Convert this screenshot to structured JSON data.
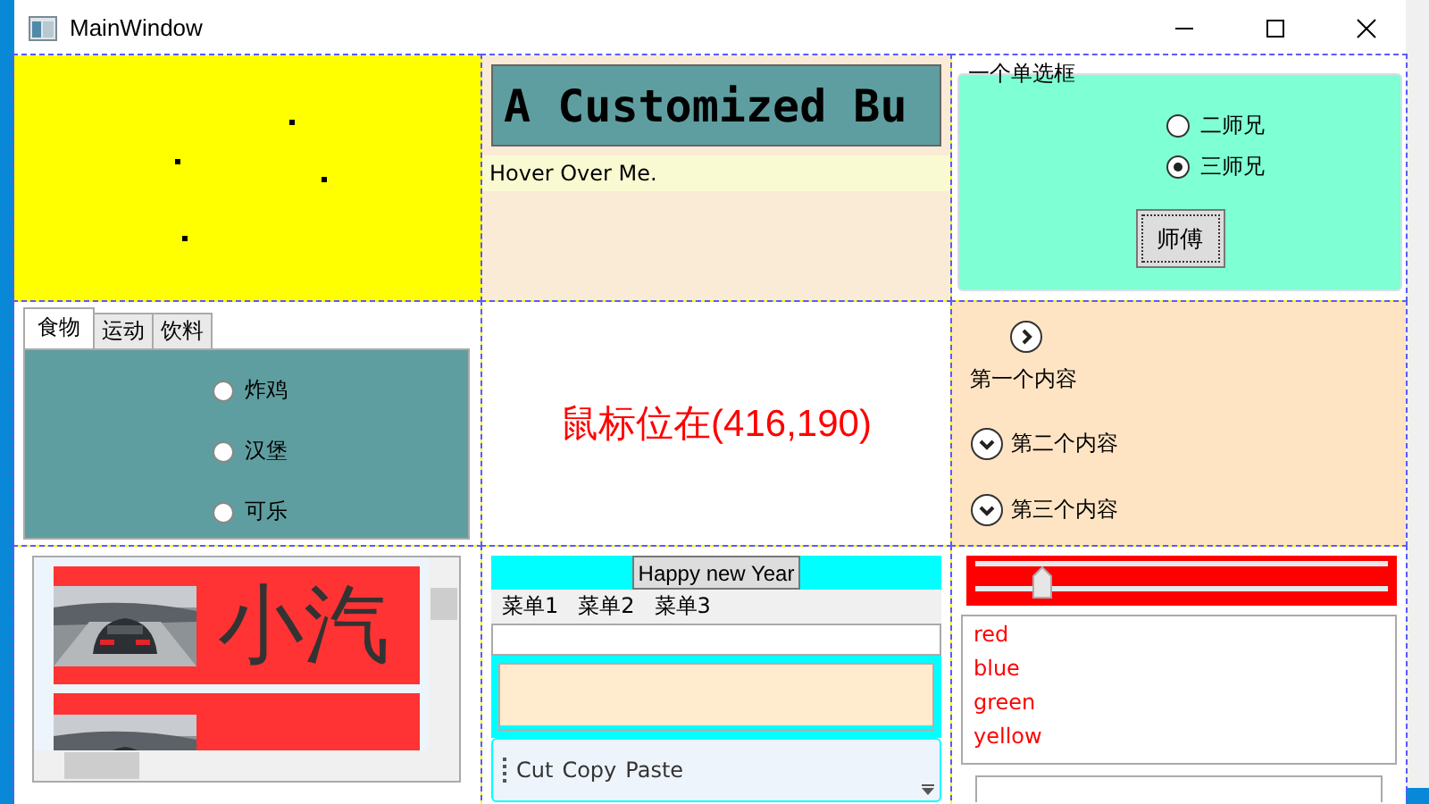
{
  "window": {
    "title": "MainWindow"
  },
  "custom_button": {
    "label": "A Customized Bu"
  },
  "hover_label": "Hover Over Me.",
  "group": {
    "header": "一个单选框",
    "button": "师傅",
    "options": [
      {
        "label": "二师兄",
        "selected": false
      },
      {
        "label": "三师兄",
        "selected": true
      }
    ]
  },
  "tabs": [
    {
      "label": "食物",
      "selected": true
    },
    {
      "label": "运动",
      "selected": false
    },
    {
      "label": "饮料",
      "selected": false
    }
  ],
  "tab_options": [
    {
      "label": "炸鸡",
      "selected": false
    },
    {
      "label": "汉堡",
      "selected": false
    },
    {
      "label": "可乐",
      "selected": false
    }
  ],
  "mouse_text": "鼠标位在(416,190)",
  "expanders": [
    {
      "header": "第一个内容",
      "kind": "right"
    },
    {
      "header": "第二个内容",
      "kind": "down"
    },
    {
      "header": "第三个内容",
      "kind": "down"
    }
  ],
  "car_items": [
    {
      "kind": "full",
      "text": "小汽"
    },
    {
      "kind": "partial"
    }
  ],
  "happy_button": "Happy new Year",
  "menu": [
    "菜单1",
    "菜单2",
    "菜单3"
  ],
  "toolbar": [
    "Cut",
    "Copy",
    "Paste"
  ],
  "slider": {
    "level": 0.14
  },
  "list": [
    "red",
    "blue",
    "green",
    "yellow"
  ]
}
